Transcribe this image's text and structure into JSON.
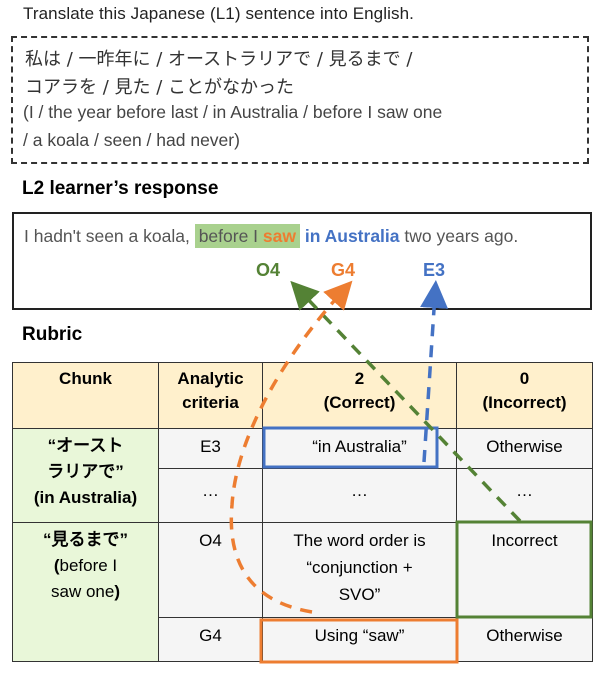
{
  "instruction": "Translate this Japanese (L1) sentence into English.",
  "source": {
    "japanese_line1": "私は / 一昨年に / オーストラリアで / 見るまで /",
    "japanese_line2": "コアラを / 見た / ことがなかった",
    "gloss_line1": "(I / the year before last / in Australia / before I saw one",
    "gloss_line2": "/ a koala / seen / had never)"
  },
  "response": {
    "heading": "L2 learner’s response",
    "text_pre": "I hadn't seen a koala, ",
    "highlight_pre": "before I ",
    "highlight_saw": "saw",
    "space": " ",
    "aus": "in Australia",
    "text_post": " two years ago.",
    "labels": {
      "o4": "O4",
      "g4": "G4",
      "e3": "E3"
    }
  },
  "rubric": {
    "heading": "Rubric",
    "headers": {
      "chunk": "Chunk",
      "criteria_1": "Analytic",
      "criteria_2": "criteria",
      "score2_1": "2",
      "score2_2": "(Correct)",
      "score0_1": "0",
      "score0_2": "(Incorrect)"
    },
    "chunks": [
      {
        "ja_1": "“オースト",
        "ja_2": "ラリアで”",
        "gloss": "(in Australia)"
      },
      {
        "ja": "“見るまで”",
        "gloss_open": "(",
        "gloss_1": "before I",
        "gloss_2": "saw one",
        "gloss_close": ")"
      }
    ],
    "rows": [
      {
        "criterion": "E3",
        "correct": "“in Australia”",
        "incorrect": "Otherwise"
      },
      {
        "criterion": "…",
        "correct": "…",
        "incorrect": "…"
      },
      {
        "criterion": "O4",
        "correct_1": "The word order is",
        "correct_2": "“conjunction +",
        "correct_3": "SVO”",
        "incorrect": "Incorrect"
      },
      {
        "criterion": "G4",
        "correct": "Using “saw”",
        "incorrect": "Otherwise"
      }
    ]
  },
  "colors": {
    "green": "#548235",
    "orange": "#ed7d31",
    "blue": "#4472c4",
    "highlight": "#a9d18e",
    "header_bg": "#fff0cc",
    "chunk_bg": "#e9f7d9"
  }
}
